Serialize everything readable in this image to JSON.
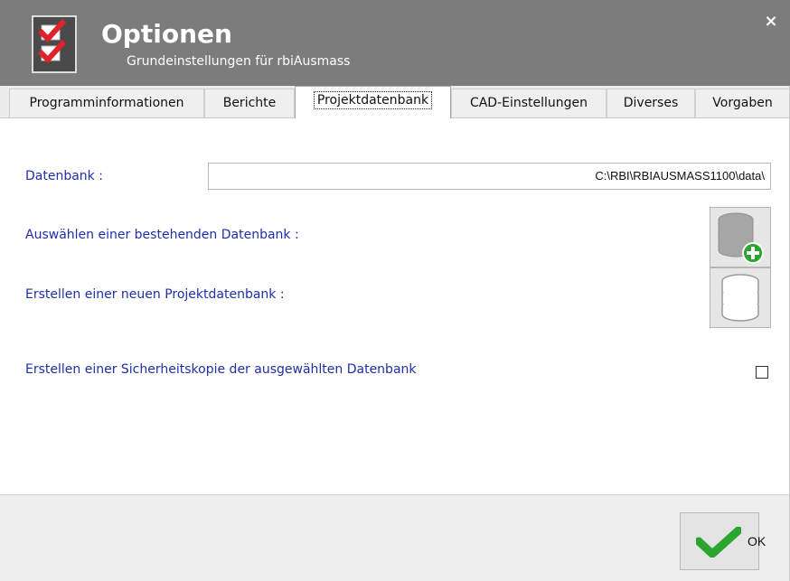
{
  "window": {
    "title": "Optionen",
    "subtitle": "Grundeinstellungen für rbiAusmass",
    "close_glyph": "×",
    "icon": "checklist-icon"
  },
  "tabs": [
    {
      "label": "Programminformationen",
      "active": false
    },
    {
      "label": "Berichte",
      "active": false
    },
    {
      "label": "Projektdatenbank",
      "active": true
    },
    {
      "label": "CAD-Einstellungen",
      "active": false
    },
    {
      "label": "Diverses",
      "active": false
    },
    {
      "label": "Vorgaben",
      "active": false
    }
  ],
  "project_db": {
    "database_label": "Datenbank :",
    "database_path": "C:\\RBI\\RBIAUSMASS1100\\data\\",
    "select_label": "Auswählen einer bestehenden Datenbank :",
    "select_icon": "database-add-icon",
    "create_label": "Erstellen einer neuen  Projektdatenbank :",
    "create_icon": "database-icon",
    "backup_label": "Erstellen einer Sicherheitskopie der ausgewählten Datenbank",
    "backup_checked": false
  },
  "footer": {
    "ok_label": "OK",
    "ok_icon": "checkmark-icon"
  },
  "colors": {
    "titlebar": "#7c7c7c",
    "label_blue": "#1f2fa8",
    "check_green": "#2aa52e",
    "accent_red": "#e0232b"
  }
}
